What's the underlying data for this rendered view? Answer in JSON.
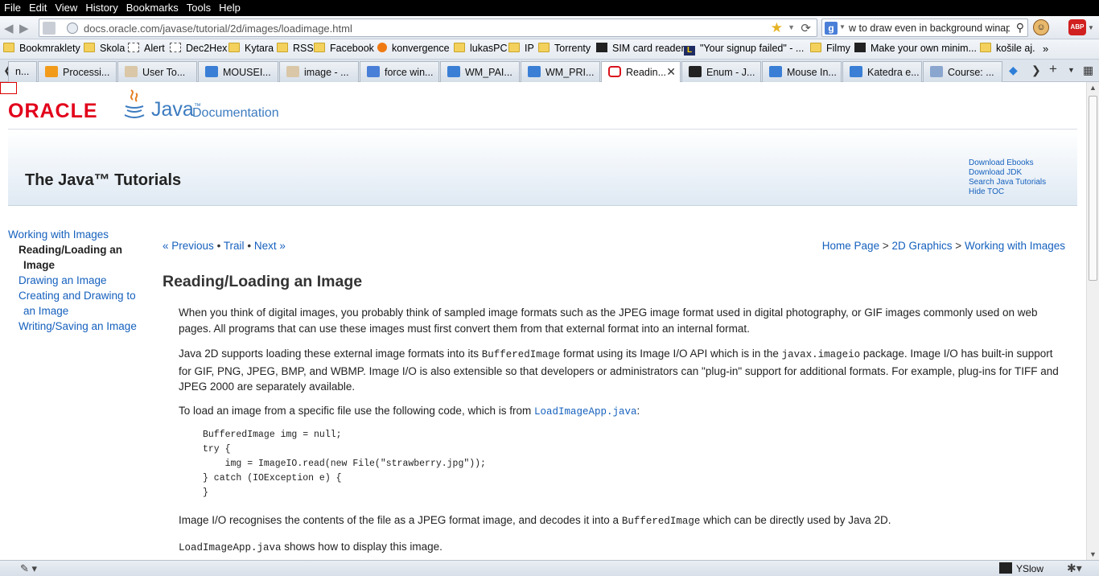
{
  "menubar": [
    "File",
    "Edit",
    "View",
    "History",
    "Bookmarks",
    "Tools",
    "Help"
  ],
  "navbar": {
    "url": "docs.oracle.com/javase/tutorial/2d/images/loadimage.html",
    "search_value": "w to draw even in background winapi"
  },
  "bookmarks": [
    "Bookmraklety",
    "Skola",
    "Alert",
    "Dec2Hex",
    "Kytara",
    "RSS",
    "Facebook",
    "konvergence",
    "lukasPC",
    "IP",
    "Torrenty",
    "SIM card reader",
    "\"Your signup failed\" - ...",
    "Filmy",
    "Make your own minim...",
    "košile aj."
  ],
  "tabs": [
    "n...",
    "Processi...",
    "User To...",
    "MOUSEI...",
    "image - ...",
    "force win...",
    "WM_PAI...",
    "WM_PRI...",
    "Readin...",
    "Enum - J...",
    "Mouse In...",
    "Katedra e...",
    "Course: ..."
  ],
  "page": {
    "logo_oracle": "ORACLE",
    "logo_java": "Java",
    "logo_trademark": "™",
    "logo_doc": "Documentation",
    "banner_title": "The Java™ Tutorials",
    "banner_links": [
      "Download Ebooks",
      "Download JDK",
      "Search Java Tutorials",
      "Hide TOC"
    ],
    "toc": {
      "parent": "Working with Images",
      "current_line1": "Reading/Loading an",
      "current_line2": "Image",
      "item2": "Drawing an Image",
      "item3_line1": "Creating and Drawing to",
      "item3_line2": "an Image",
      "item4": "Writing/Saving an Image"
    },
    "prev": "« Previous",
    "trail": "Trail",
    "next": "Next »",
    "crumb_home": "Home Page",
    "crumb_2d": "2D Graphics",
    "crumb_images": "Working with Images",
    "heading": "Reading/Loading an Image",
    "p1": "When you think of digital images, you probably think of sampled image formats such as the JPEG image format used in digital photography, or GIF images commonly used on web pages. All programs that can use these images must first convert them from that external format into an internal format.",
    "p2_a": "Java 2D supports loading these external image formats into its ",
    "p2_code1": "BufferedImage",
    "p2_b": " format using its Image I/O API which is in the ",
    "p2_code2": "javax.imageio",
    "p2_c": " package. Image I/O has built-in support for GIF, PNG, JPEG, BMP, and WBMP. Image I/O is also extensible so that developers or administrators can \"plug-in\" support for additional formats. For example, plug-ins for TIFF and JPEG 2000 are separately available.",
    "p3_a": "To load an image from a specific file use the following code, which is from ",
    "p3_link": "LoadImageApp.java",
    "p3_b": ":",
    "code": "BufferedImage img = null;\ntry {\n    img = ImageIO.read(new File(\"strawberry.jpg\"));\n} catch (IOException e) {\n}",
    "p4_a": "Image I/O recognises the contents of the file as a JPEG format image, and decodes it into a ",
    "p4_code": "BufferedImage",
    "p4_b": " which can be directly used by Java 2D.",
    "p5_code": "LoadImageApp.java",
    "p5_b": " shows how to display this image."
  },
  "statusbar": {
    "yslow": "YSlow"
  }
}
